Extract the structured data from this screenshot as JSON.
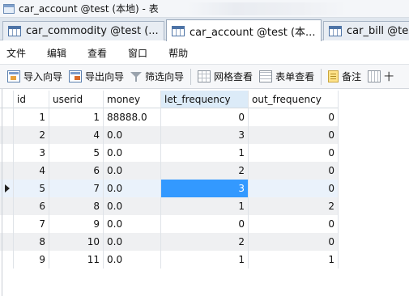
{
  "window": {
    "title": "car_account @test (本地) - 表"
  },
  "tabs": [
    {
      "label": "car_commodity @test (...",
      "close": "",
      "active": false
    },
    {
      "label": "car_account @test (本...",
      "close": "×",
      "active": true
    },
    {
      "label": "car_bill @test",
      "close": "",
      "active": false
    }
  ],
  "menu": [
    "文件",
    "编辑",
    "查看",
    "窗口",
    "帮助"
  ],
  "toolbar": {
    "import_label": "导入向导",
    "export_label": "导出向导",
    "filter_label": "筛选向导",
    "grid_view_label": "网格查看",
    "form_view_label": "表单查看",
    "note_label": "备注",
    "more_label": "十"
  },
  "columns": [
    "id",
    "userid",
    "money",
    "let_frequency",
    "out_frequency"
  ],
  "rows": [
    {
      "id": "1",
      "userid": "1",
      "money": "88888.0",
      "let_frequency": "0",
      "out_frequency": "0"
    },
    {
      "id": "2",
      "userid": "4",
      "money": "0.0",
      "let_frequency": "3",
      "out_frequency": "0"
    },
    {
      "id": "3",
      "userid": "5",
      "money": "0.0",
      "let_frequency": "1",
      "out_frequency": "0"
    },
    {
      "id": "4",
      "userid": "6",
      "money": "0.0",
      "let_frequency": "2",
      "out_frequency": "0"
    },
    {
      "id": "5",
      "userid": "7",
      "money": "0.0",
      "let_frequency": "3",
      "out_frequency": "0"
    },
    {
      "id": "6",
      "userid": "8",
      "money": "0.0",
      "let_frequency": "1",
      "out_frequency": "2"
    },
    {
      "id": "7",
      "userid": "9",
      "money": "0.0",
      "let_frequency": "0",
      "out_frequency": "0"
    },
    {
      "id": "8",
      "userid": "10",
      "money": "0.0",
      "let_frequency": "2",
      "out_frequency": "0"
    },
    {
      "id": "9",
      "userid": "11",
      "money": "0.0",
      "let_frequency": "1",
      "out_frequency": "1"
    }
  ],
  "selection": {
    "current_row_index": 4,
    "selected_column": "let_frequency"
  },
  "colors": {
    "accent": "#3399ff",
    "header_selected": "#dcebf8",
    "alt_row": "#eff0f2"
  }
}
